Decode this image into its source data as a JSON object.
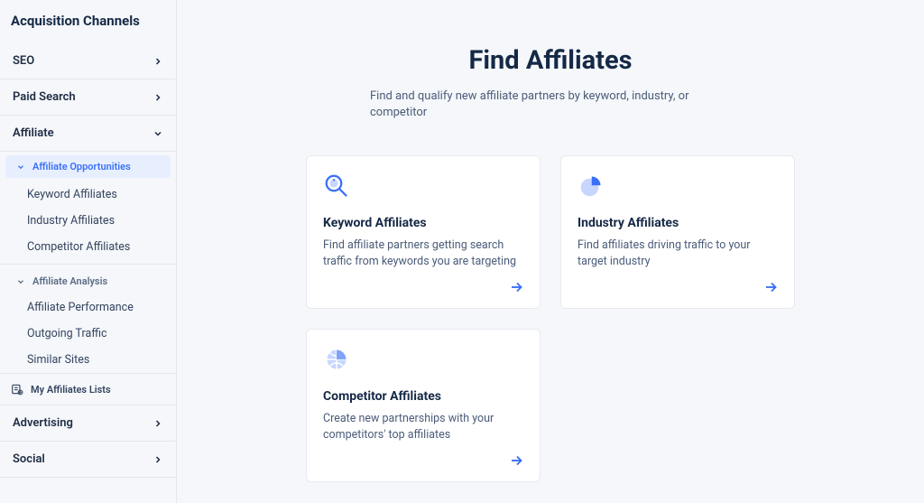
{
  "sidebar": {
    "title": "Acquisition Channels",
    "items": [
      {
        "label": "SEO"
      },
      {
        "label": "Paid Search"
      },
      {
        "label": "Affiliate"
      },
      {
        "label": "Advertising"
      },
      {
        "label": "Social"
      }
    ],
    "affiliate": {
      "opportunities": {
        "header": "Affiliate Opportunities",
        "links": [
          "Keyword Affiliates",
          "Industry Affiliates",
          "Competitor Affiliates"
        ]
      },
      "analysis": {
        "header": "Affiliate Analysis",
        "links": [
          "Affiliate Performance",
          "Outgoing Traffic",
          "Similar Sites"
        ]
      },
      "my_lists": "My Affiliates Lists"
    }
  },
  "main": {
    "title": "Find Affiliates",
    "subtitle": "Find and qualify new affiliate partners by keyword, industry, or competitor",
    "cards": [
      {
        "title": "Keyword Affiliates",
        "desc": "Find affiliate partners getting search traffic from keywords you are targeting"
      },
      {
        "title": "Industry Affiliates",
        "desc": "Find affiliates driving traffic to your target industry"
      },
      {
        "title": "Competitor Affiliates",
        "desc": "Create new partnerships with your competitors' top affiliates"
      }
    ]
  },
  "colors": {
    "accent": "#3a6ff8"
  }
}
